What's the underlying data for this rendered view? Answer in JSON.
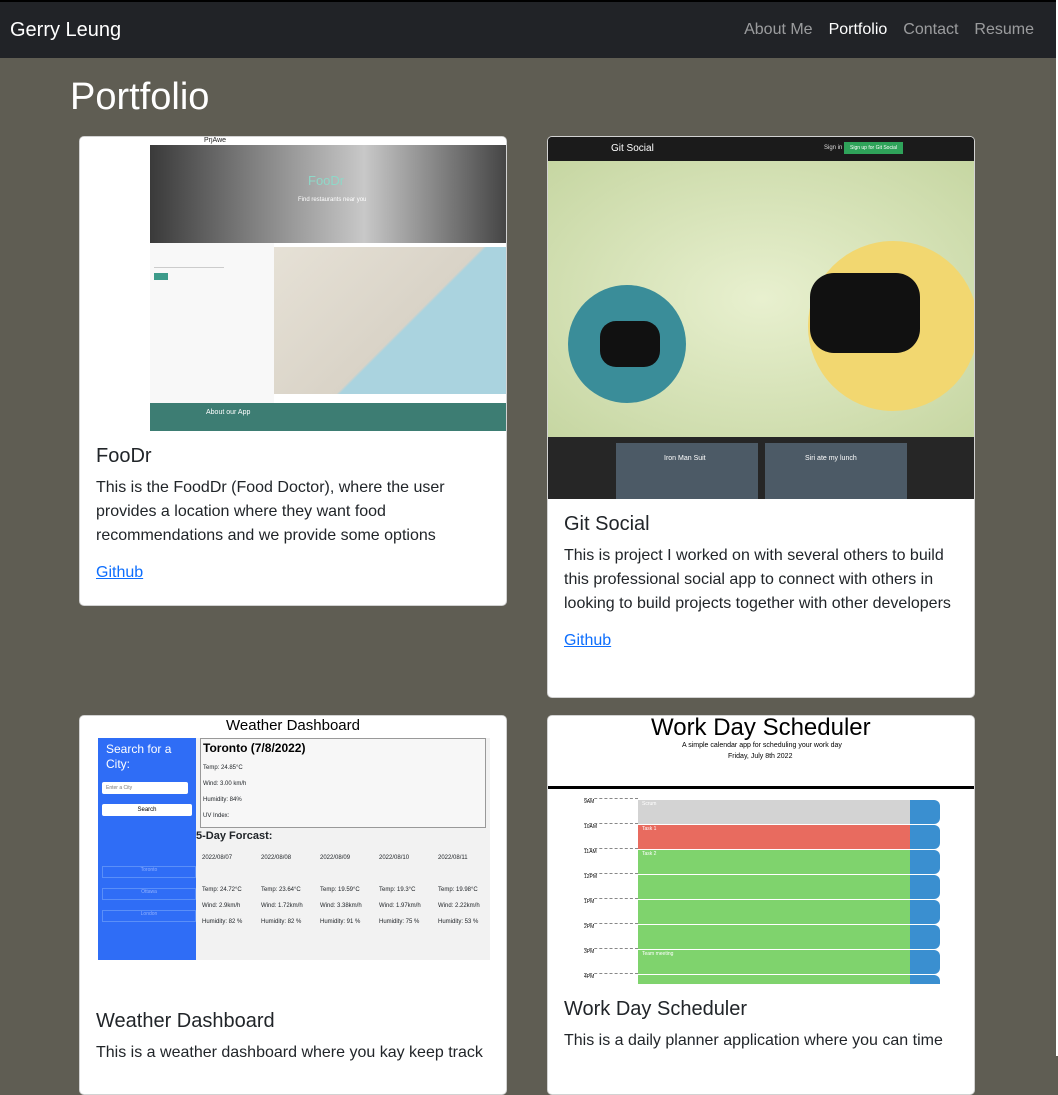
{
  "nav": {
    "brand": "Gerry Leung",
    "links": [
      {
        "label": "About Me",
        "active": false
      },
      {
        "label": "Portfolio",
        "active": true
      },
      {
        "label": "Contact",
        "active": false
      },
      {
        "label": "Resume",
        "active": false
      }
    ]
  },
  "page": {
    "title": "Portfolio"
  },
  "projects": [
    {
      "title": "FooDr",
      "description": "This is the FoodDr (Food Doctor), where the user provides a location where they want food recommendations and we provide some options",
      "link_label": "Github",
      "screenshot": {
        "app_name": "PrjAwe",
        "hero_text": "FooDr",
        "hero_sub": "Find restaurants near you",
        "footer_text": "About our App"
      }
    },
    {
      "title": "Git Social",
      "description": "This is project I worked on with several others to build this professional social app to connect with others in looking to build projects together with other developers",
      "link_label": "Github",
      "screenshot": {
        "app_name": "Git Social",
        "signin": "Sign in",
        "signup": "Sign up for Git Social",
        "post1": "Iron Man Suit",
        "post2": "Siri ate my lunch"
      }
    },
    {
      "title": "Weather Dashboard",
      "description": "This is a weather dashboard where you kay keep track",
      "link_label": "Github",
      "screenshot": {
        "header": "Weather Dashboard",
        "search_label": "Search for a City:",
        "search_placeholder": "Enter a City",
        "search_button": "Search",
        "history": [
          "Toronto",
          "Ottawa",
          "London"
        ],
        "current_city": "Toronto (7/8/2022)",
        "current": [
          "Temp: 24.85°C",
          "Wind: 3.00 km/h",
          "Humidity: 84%",
          "UV Index:"
        ],
        "forecast_title": "5-Day Forcast:",
        "forecast": [
          {
            "date": "2022/08/07",
            "temp": "Temp: 24.72°C",
            "wind": "Wind: 2.9km/h",
            "hum": "Humidity: 82 %"
          },
          {
            "date": "2022/08/08",
            "temp": "Temp: 23.64°C",
            "wind": "Wind: 1.72km/h",
            "hum": "Humidity: 82 %"
          },
          {
            "date": "2022/08/09",
            "temp": "Temp: 19.59°C",
            "wind": "Wind: 3.38km/h",
            "hum": "Humidity: 91 %"
          },
          {
            "date": "2022/08/10",
            "temp": "Temp: 19.3°C",
            "wind": "Wind: 1.97km/h",
            "hum": "Humidity: 75 %"
          },
          {
            "date": "2022/08/11",
            "temp": "Temp: 19.98°C",
            "wind": "Wind: 2.22km/h",
            "hum": "Humidity: 53 %"
          }
        ]
      }
    },
    {
      "title": "Work Day Scheduler",
      "description": "This is a daily planner application where you can time",
      "link_label": "Github",
      "screenshot": {
        "header": "Work Day Scheduler",
        "sub": "A simple calendar app for scheduling your work day",
        "date": "Friday, July 8th 2022",
        "hours": [
          "9AM",
          "10AM",
          "11AM",
          "12PM",
          "1PM",
          "2PM",
          "3PM",
          "4PM"
        ],
        "notes": [
          "Scrum",
          "Task 1",
          "Task 2",
          "",
          "",
          "",
          "Team meeting",
          ""
        ],
        "row_colors": [
          "#d3d3d3",
          "#e86b5f",
          "#7fd36d",
          "#7fd36d",
          "#7fd36d",
          "#7fd36d",
          "#7fd36d",
          "#7fd36d"
        ]
      }
    }
  ]
}
